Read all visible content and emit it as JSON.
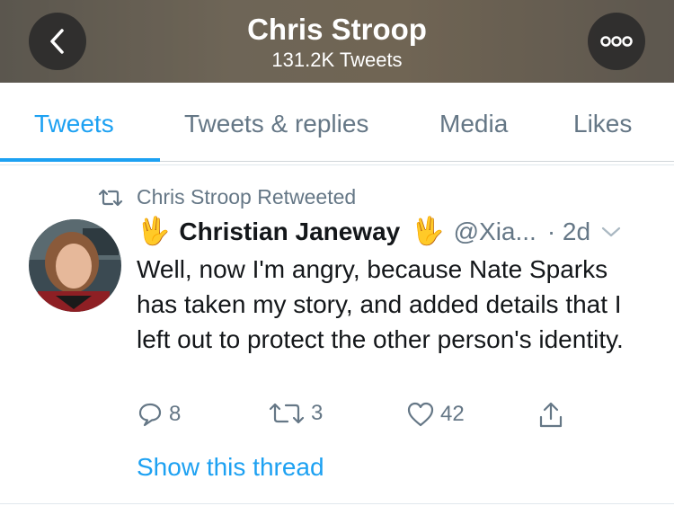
{
  "header": {
    "title": "Chris Stroop",
    "subtitle": "131.2K Tweets",
    "back_icon": "chevron-left-icon",
    "more_icon": "more-dots-icon"
  },
  "tabs": [
    {
      "label": "Tweets",
      "active": true
    },
    {
      "label": "Tweets & replies",
      "active": false
    },
    {
      "label": "Media",
      "active": false
    },
    {
      "label": "Likes",
      "active": false
    }
  ],
  "tweet": {
    "retweet_label": "Chris Stroop Retweeted",
    "emoji": "🖖",
    "author_name": "Christian Janeway",
    "handle": "@Xia...",
    "time": "· 2d",
    "text": "Well, now I'm angry, because Nate Sparks has taken my story, and added details that I left out to protect the other person's identity.",
    "actions": {
      "replies": "8",
      "retweets": "3",
      "likes": "42"
    },
    "show_thread": "Show this thread"
  },
  "colors": {
    "accent": "#1da1f2",
    "muted": "#657786",
    "text": "#14171a"
  }
}
